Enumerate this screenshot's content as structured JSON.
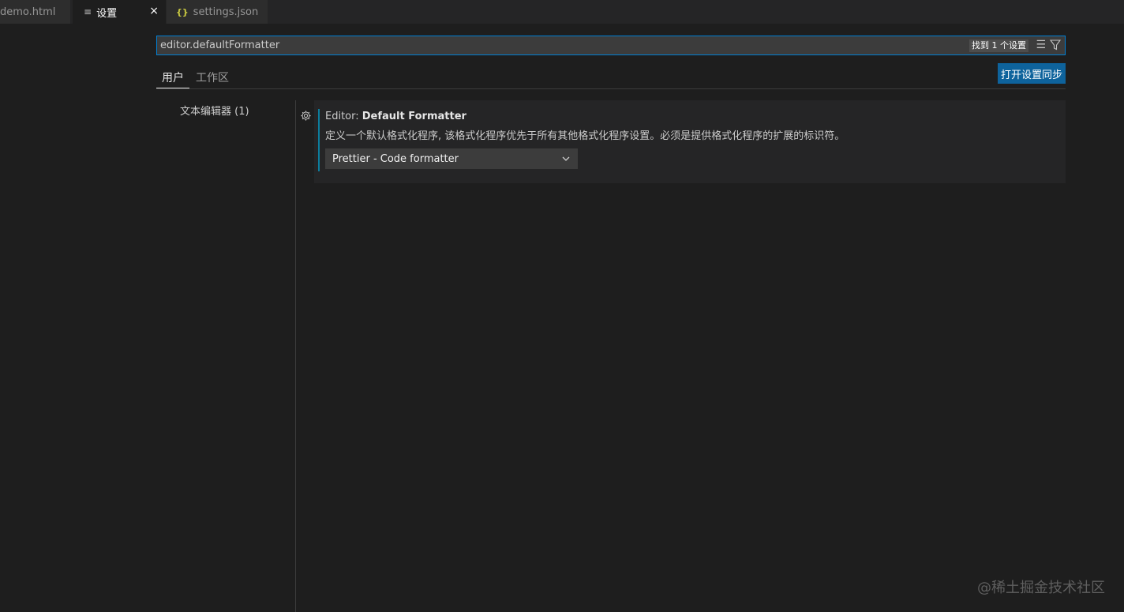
{
  "tabs": [
    {
      "label": "demo.html",
      "icon": "html-file-icon"
    },
    {
      "label": "设置",
      "icon": "settings-editor-icon",
      "active": true,
      "close": "×"
    },
    {
      "label": "settings.json",
      "icon": "json-file-icon"
    }
  ],
  "search": {
    "value": "editor.defaultFormatter",
    "result_count": "找到 1 个设置"
  },
  "scope_tabs": [
    "用户",
    "工作区"
  ],
  "sync_button": "打开设置同步",
  "toc": {
    "item": "文本编辑器 (1)"
  },
  "setting": {
    "category": "Editor: ",
    "name": "Default Formatter",
    "description": "定义一个默认格式化程序, 该格式化程序优先于所有其他格式化程序设置。必须是提供格式化程序的扩展的标识符。",
    "selected_value": "Prettier - Code formatter"
  },
  "watermark": "@稀土掘金技术社区",
  "colors": {
    "accent": "#007fd4",
    "button": "#0e639c",
    "modified": "#0c7d9d",
    "background": "#1e1e1e"
  }
}
